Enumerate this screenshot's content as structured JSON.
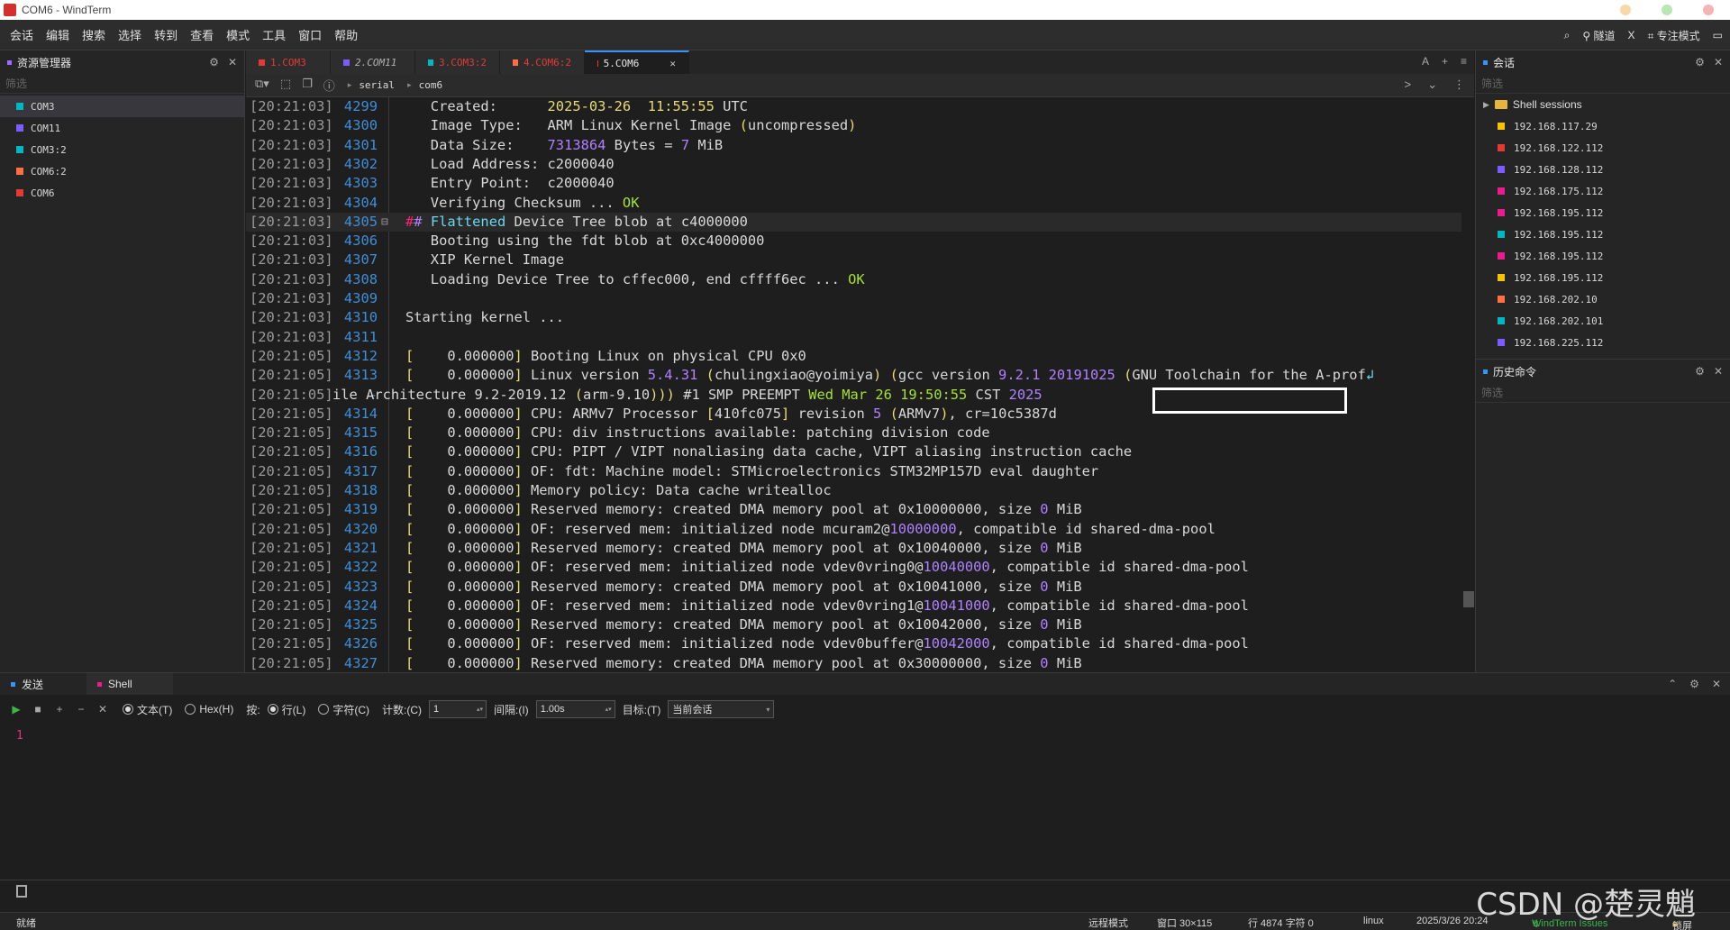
{
  "window": {
    "title": "COM6 - WindTerm"
  },
  "menu": [
    "会话",
    "编辑",
    "搜索",
    "选择",
    "转到",
    "查看",
    "模式",
    "工具",
    "窗口",
    "帮助"
  ],
  "toolbar_right": {
    "tunnel": "隧道",
    "x": "X",
    "focus_mode": "专注模式"
  },
  "explorer": {
    "title": "资源管理器",
    "filter_placeholder": "筛选",
    "items": [
      {
        "label": "COM3",
        "color": "#00b7c3"
      },
      {
        "label": "COM11",
        "color": "#7a5cff"
      },
      {
        "label": "COM3:2",
        "color": "#00b7c3"
      },
      {
        "label": "COM6:2",
        "color": "#ff7043"
      },
      {
        "label": "COM6",
        "color": "#e53935"
      }
    ]
  },
  "tabs": [
    {
      "label": "1.COM3",
      "color": "#e53935",
      "text_color": "#e53935"
    },
    {
      "label": "2.COM11",
      "color": "#7a5cff",
      "text_color": "#b0b0b0"
    },
    {
      "label": "3.COM3:2",
      "color": "#00b7c3",
      "text_color": "#e53935"
    },
    {
      "label": "4.COM6:2",
      "color": "#ff7043",
      "text_color": "#e53935"
    },
    {
      "label": "5.COM6",
      "color": "#e53935",
      "text_color": "#e8e8e8"
    }
  ],
  "tab_tools": {
    "font": "A",
    "add": "+",
    "menu": "≡"
  },
  "address": {
    "crumbs": [
      "serial",
      "com6"
    ]
  },
  "terminal": {
    "lines": [
      {
        "ts": "[20:21:03]",
        "ln": "4299",
        "segs": [
          [
            "   Created:      ",
            ""
          ],
          [
            "2025-03-26  11:55:55",
            "c-yellow"
          ],
          [
            " UTC",
            ""
          ]
        ]
      },
      {
        "ts": "[20:21:03]",
        "ln": "4300",
        "segs": [
          [
            "   Image Type:   ARM Linux Kernel Image ",
            ""
          ],
          [
            "(",
            "c-yellow"
          ],
          [
            "uncompressed",
            ""
          ],
          [
            ")",
            "c-yellow"
          ]
        ]
      },
      {
        "ts": "[20:21:03]",
        "ln": "4301",
        "segs": [
          [
            "   Data Size:    ",
            ""
          ],
          [
            "7313864",
            "c-purple"
          ],
          [
            " Bytes = ",
            ""
          ],
          [
            "7",
            "c-purple"
          ],
          [
            " MiB",
            ""
          ]
        ]
      },
      {
        "ts": "[20:21:03]",
        "ln": "4302",
        "segs": [
          [
            "   Load Address: c2000040",
            ""
          ]
        ]
      },
      {
        "ts": "[20:21:03]",
        "ln": "4303",
        "segs": [
          [
            "   Entry Point:  c2000040",
            ""
          ]
        ]
      },
      {
        "ts": "[20:21:03]",
        "ln": "4304",
        "segs": [
          [
            "   Verifying Checksum ... ",
            ""
          ],
          [
            "OK",
            "c-green"
          ]
        ]
      },
      {
        "ts": "[20:21:03]",
        "ln": "4305",
        "hl": true,
        "segs": [
          [
            "#",
            "c-red"
          ],
          [
            "# ",
            "c-purple"
          ],
          [
            "Flattened",
            "c-cyan"
          ],
          [
            " Device Tree blob at c4000000",
            ""
          ]
        ]
      },
      {
        "ts": "[20:21:03]",
        "ln": "4306",
        "segs": [
          [
            "   Booting using the fdt blob at 0xc4000000",
            ""
          ]
        ]
      },
      {
        "ts": "[20:21:03]",
        "ln": "4307",
        "segs": [
          [
            "   XIP Kernel Image",
            ""
          ]
        ]
      },
      {
        "ts": "[20:21:03]",
        "ln": "4308",
        "segs": [
          [
            "   Loading Device Tree to cffec000, end cffff6ec ... ",
            ""
          ],
          [
            "OK",
            "c-green"
          ]
        ]
      },
      {
        "ts": "[20:21:03]",
        "ln": "4309",
        "segs": [
          [
            "",
            ""
          ]
        ]
      },
      {
        "ts": "[20:21:03]",
        "ln": "4310",
        "segs": [
          [
            "Starting kernel ...",
            ""
          ]
        ]
      },
      {
        "ts": "[20:21:03]",
        "ln": "4311",
        "segs": [
          [
            "",
            ""
          ]
        ]
      },
      {
        "ts": "[20:21:05]",
        "ln": "4312",
        "segs": [
          [
            "[",
            "c-yellow"
          ],
          [
            "    0.000000",
            ""
          ],
          [
            "]",
            "c-yellow"
          ],
          [
            " Booting Linux on physical CPU 0x0",
            ""
          ]
        ]
      },
      {
        "ts": "[20:21:05]",
        "ln": "4313",
        "segs": [
          [
            "[",
            "c-yellow"
          ],
          [
            "    0.000000",
            ""
          ],
          [
            "]",
            "c-yellow"
          ],
          [
            " Linux version ",
            ""
          ],
          [
            "5.4.31",
            "c-purple"
          ],
          [
            " ",
            ""
          ],
          [
            "(",
            "c-yellow"
          ],
          [
            "chulingxiao@yoimiya",
            ""
          ],
          [
            ")",
            "c-yellow"
          ],
          [
            " ",
            ""
          ],
          [
            "(",
            "c-yellow"
          ],
          [
            "gcc version ",
            ""
          ],
          [
            "9.2.1 20191025",
            "c-purple"
          ],
          [
            " ",
            ""
          ],
          [
            "(",
            "c-yellow"
          ],
          [
            "GNU Toolchain for the A-prof",
            ""
          ],
          [
            "↲",
            "c-cyan"
          ]
        ]
      },
      {
        "ts": "[20:21:05]",
        "ln": "-",
        "segs": [
          [
            "ile Architecture 9.2-2019.12 ",
            "WRAP"
          ],
          [
            "(",
            "c-yellow"
          ],
          [
            "arm-9.10",
            ""
          ],
          [
            ")))",
            "c-yellow"
          ],
          [
            " #1 SMP PREEMPT ",
            ""
          ],
          [
            "Wed Mar 26 19:50:55",
            "c-green"
          ],
          [
            " CST ",
            ""
          ],
          [
            "2025",
            "c-purple"
          ]
        ]
      },
      {
        "ts": "[20:21:05]",
        "ln": "4314",
        "segs": [
          [
            "[",
            "c-yellow"
          ],
          [
            "    0.000000",
            ""
          ],
          [
            "]",
            "c-yellow"
          ],
          [
            " CPU: ARMv7 Processor ",
            ""
          ],
          [
            "[",
            "c-yellow"
          ],
          [
            "410fc075",
            ""
          ],
          [
            "]",
            "c-yellow"
          ],
          [
            " revision ",
            ""
          ],
          [
            "5",
            "c-purple"
          ],
          [
            " ",
            ""
          ],
          [
            "(",
            "c-yellow"
          ],
          [
            "ARMv7",
            ""
          ],
          [
            ")",
            "c-yellow"
          ],
          [
            ", cr=10c5387d",
            ""
          ]
        ]
      },
      {
        "ts": "[20:21:05]",
        "ln": "4315",
        "segs": [
          [
            "[",
            "c-yellow"
          ],
          [
            "    0.000000",
            ""
          ],
          [
            "]",
            "c-yellow"
          ],
          [
            " CPU: div instructions available: patching division code",
            ""
          ]
        ]
      },
      {
        "ts": "[20:21:05]",
        "ln": "4316",
        "segs": [
          [
            "[",
            "c-yellow"
          ],
          [
            "    0.000000",
            ""
          ],
          [
            "]",
            "c-yellow"
          ],
          [
            " CPU: PIPT / VIPT nonaliasing data cache, VIPT aliasing instruction cache",
            ""
          ]
        ]
      },
      {
        "ts": "[20:21:05]",
        "ln": "4317",
        "segs": [
          [
            "[",
            "c-yellow"
          ],
          [
            "    0.000000",
            ""
          ],
          [
            "]",
            "c-yellow"
          ],
          [
            " OF: fdt: Machine model: STMicroelectronics STM32MP157D eval daughter",
            ""
          ]
        ]
      },
      {
        "ts": "[20:21:05]",
        "ln": "4318",
        "segs": [
          [
            "[",
            "c-yellow"
          ],
          [
            "    0.000000",
            ""
          ],
          [
            "]",
            "c-yellow"
          ],
          [
            " Memory policy: Data cache writealloc",
            ""
          ]
        ]
      },
      {
        "ts": "[20:21:05]",
        "ln": "4319",
        "segs": [
          [
            "[",
            "c-yellow"
          ],
          [
            "    0.000000",
            ""
          ],
          [
            "]",
            "c-yellow"
          ],
          [
            " Reserved memory: created DMA memory pool at 0x10000000, size ",
            ""
          ],
          [
            "0",
            "c-purple"
          ],
          [
            " MiB",
            ""
          ]
        ]
      },
      {
        "ts": "[20:21:05]",
        "ln": "4320",
        "segs": [
          [
            "[",
            "c-yellow"
          ],
          [
            "    0.000000",
            ""
          ],
          [
            "]",
            "c-yellow"
          ],
          [
            " OF: reserved mem: initialized node mcuram2@",
            ""
          ],
          [
            "10000000",
            "c-purple"
          ],
          [
            ", compatible id shared-dma-pool",
            ""
          ]
        ]
      },
      {
        "ts": "[20:21:05]",
        "ln": "4321",
        "segs": [
          [
            "[",
            "c-yellow"
          ],
          [
            "    0.000000",
            ""
          ],
          [
            "]",
            "c-yellow"
          ],
          [
            " Reserved memory: created DMA memory pool at 0x10040000, size ",
            ""
          ],
          [
            "0",
            "c-purple"
          ],
          [
            " MiB",
            ""
          ]
        ]
      },
      {
        "ts": "[20:21:05]",
        "ln": "4322",
        "segs": [
          [
            "[",
            "c-yellow"
          ],
          [
            "    0.000000",
            ""
          ],
          [
            "]",
            "c-yellow"
          ],
          [
            " OF: reserved mem: initialized node vdev0vring0@",
            ""
          ],
          [
            "10040000",
            "c-purple"
          ],
          [
            ", compatible id shared-dma-pool",
            ""
          ]
        ]
      },
      {
        "ts": "[20:21:05]",
        "ln": "4323",
        "segs": [
          [
            "[",
            "c-yellow"
          ],
          [
            "    0.000000",
            ""
          ],
          [
            "]",
            "c-yellow"
          ],
          [
            " Reserved memory: created DMA memory pool at 0x10041000, size ",
            ""
          ],
          [
            "0",
            "c-purple"
          ],
          [
            " MiB",
            ""
          ]
        ]
      },
      {
        "ts": "[20:21:05]",
        "ln": "4324",
        "segs": [
          [
            "[",
            "c-yellow"
          ],
          [
            "    0.000000",
            ""
          ],
          [
            "]",
            "c-yellow"
          ],
          [
            " OF: reserved mem: initialized node vdev0vring1@",
            ""
          ],
          [
            "10041000",
            "c-purple"
          ],
          [
            ", compatible id shared-dma-pool",
            ""
          ]
        ]
      },
      {
        "ts": "[20:21:05]",
        "ln": "4325",
        "segs": [
          [
            "[",
            "c-yellow"
          ],
          [
            "    0.000000",
            ""
          ],
          [
            "]",
            "c-yellow"
          ],
          [
            " Reserved memory: created DMA memory pool at 0x10042000, size ",
            ""
          ],
          [
            "0",
            "c-purple"
          ],
          [
            " MiB",
            ""
          ]
        ]
      },
      {
        "ts": "[20:21:05]",
        "ln": "4326",
        "segs": [
          [
            "[",
            "c-yellow"
          ],
          [
            "    0.000000",
            ""
          ],
          [
            "]",
            "c-yellow"
          ],
          [
            " OF: reserved mem: initialized node vdev0buffer@",
            ""
          ],
          [
            "10042000",
            "c-purple"
          ],
          [
            ", compatible id shared-dma-pool",
            ""
          ]
        ]
      },
      {
        "ts": "[20:21:05]",
        "ln": "4327",
        "segs": [
          [
            "[",
            "c-yellow"
          ],
          [
            "    0.000000",
            ""
          ],
          [
            "]",
            "c-yellow"
          ],
          [
            " Reserved memory: created DMA memory pool at 0x30000000, size ",
            ""
          ],
          [
            "0",
            "c-purple"
          ],
          [
            " MiB",
            ""
          ]
        ]
      }
    ]
  },
  "sessions": {
    "title": "会话",
    "filter_placeholder": "筛选",
    "folder": "Shell sessions",
    "items": [
      {
        "label": "192.168.117.29",
        "color": "#f5c400"
      },
      {
        "label": "192.168.122.112",
        "color": "#e53935"
      },
      {
        "label": "192.168.128.112",
        "color": "#7a5cff"
      },
      {
        "label": "192.168.175.112",
        "color": "#e91e8c"
      },
      {
        "label": "192.168.195.112",
        "color": "#e91e8c"
      },
      {
        "label": "192.168.195.112",
        "color": "#00b7c3"
      },
      {
        "label": "192.168.195.112",
        "color": "#e91e8c"
      },
      {
        "label": "192.168.195.112",
        "color": "#f5c400"
      },
      {
        "label": "192.168.202.10",
        "color": "#ff7043"
      },
      {
        "label": "192.168.202.101",
        "color": "#00b7c3"
      },
      {
        "label": "192.168.225.112",
        "color": "#7a5cff"
      }
    ]
  },
  "history": {
    "title": "历史命令",
    "filter_placeholder": "筛选"
  },
  "send": {
    "tabs": [
      "发送",
      "Shell"
    ],
    "text_mode": "文本(T)",
    "hex_mode": "Hex(H)",
    "by_label": "按:",
    "line_mode": "行(L)",
    "char_mode": "字符(C)",
    "count_label": "计数:(C)",
    "count_value": "1",
    "interval_label": "间隔:(I)",
    "interval_value": "1.00s",
    "target_label": "目标:(T)",
    "target_value": "当前会话",
    "editor_line": "1"
  },
  "status": {
    "ready": "就绪",
    "remote_mode": "远程模式",
    "window": "窗口 30×115",
    "position": "行 4874 字符 0",
    "os": "linux",
    "datetime": "2025/3/26 20:24",
    "issues": "WindTerm Issues",
    "lock": "锁屏"
  },
  "watermark": "CSDN @楚灵魈"
}
